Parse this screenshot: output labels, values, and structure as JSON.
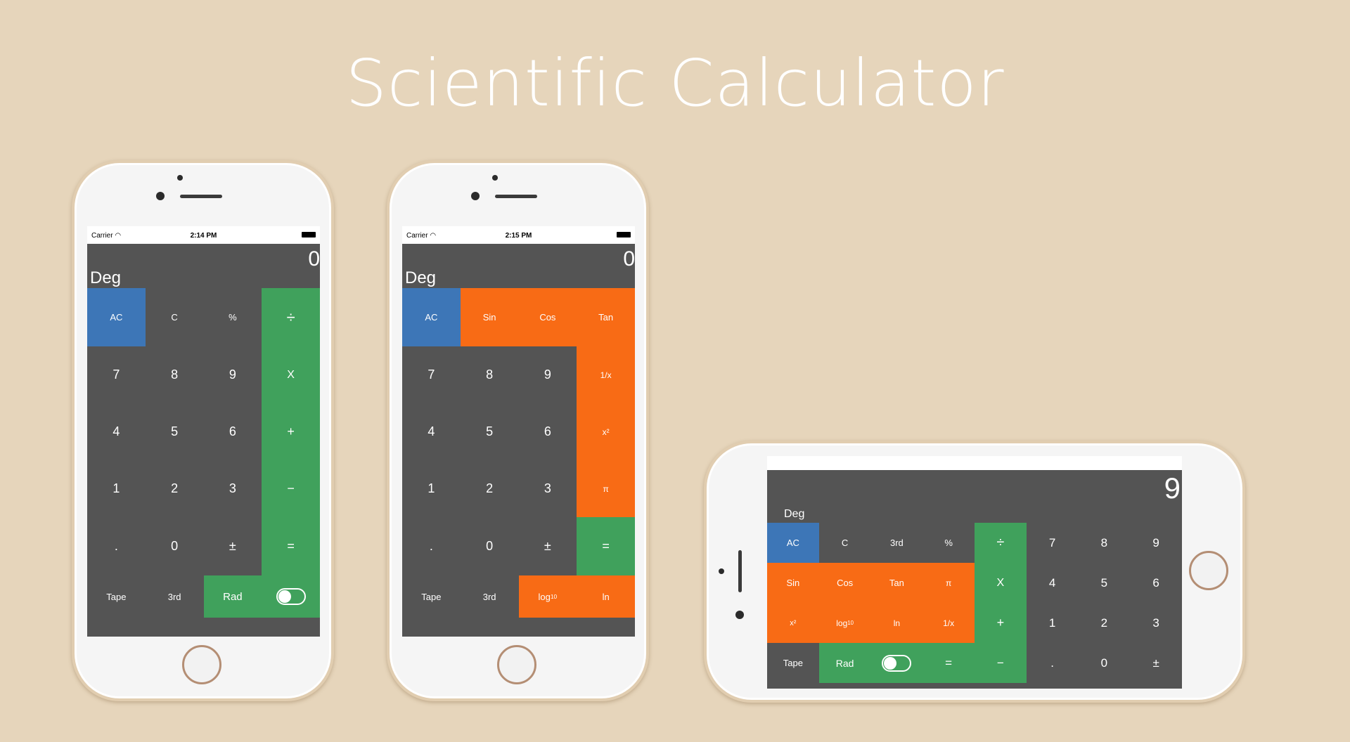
{
  "page": {
    "title": "Scientific Calculator"
  },
  "portrait_basic": {
    "status": {
      "carrier": "Carrier",
      "time": "2:14 PM"
    },
    "display": "0",
    "mode": "Deg",
    "keys": [
      "AC",
      "C",
      "%",
      "÷",
      "7",
      "8",
      "9",
      "X",
      "4",
      "5",
      "6",
      "+",
      "1",
      "2",
      "3",
      "−",
      ".",
      "0",
      "±",
      "=",
      "Tape",
      "3rd",
      "Rad"
    ]
  },
  "portrait_sci": {
    "status": {
      "carrier": "Carrier",
      "time": "2:15 PM"
    },
    "display": "0",
    "mode": "Deg",
    "keys": [
      "AC",
      "Sin",
      "Cos",
      "Tan",
      "7",
      "8",
      "9",
      "1/x",
      "4",
      "5",
      "6",
      "x²",
      "1",
      "2",
      "3",
      "π",
      ".",
      "0",
      "±",
      "=",
      "Tape",
      "3rd",
      "log",
      "10",
      "ln"
    ]
  },
  "landscape": {
    "display": "9",
    "mode": "Deg",
    "keys": [
      "AC",
      "C",
      "3rd",
      "%",
      "÷",
      "7",
      "8",
      "9",
      "Sin",
      "Cos",
      "Tan",
      "π",
      "X",
      "4",
      "5",
      "6",
      "x²",
      "log",
      "10",
      "ln",
      "1/x",
      "+",
      "1",
      "2",
      "3",
      "Tape",
      "Rad",
      "=",
      "−",
      ".",
      "0",
      "±"
    ]
  },
  "colors": {
    "background": "#e6d5bb",
    "blue": "#3d76b7",
    "orange": "#f86b15",
    "green": "#40a15c",
    "dark": "#545454"
  },
  "icons": [
    "wifi-icon",
    "battery-icon",
    "toggle-switch"
  ]
}
